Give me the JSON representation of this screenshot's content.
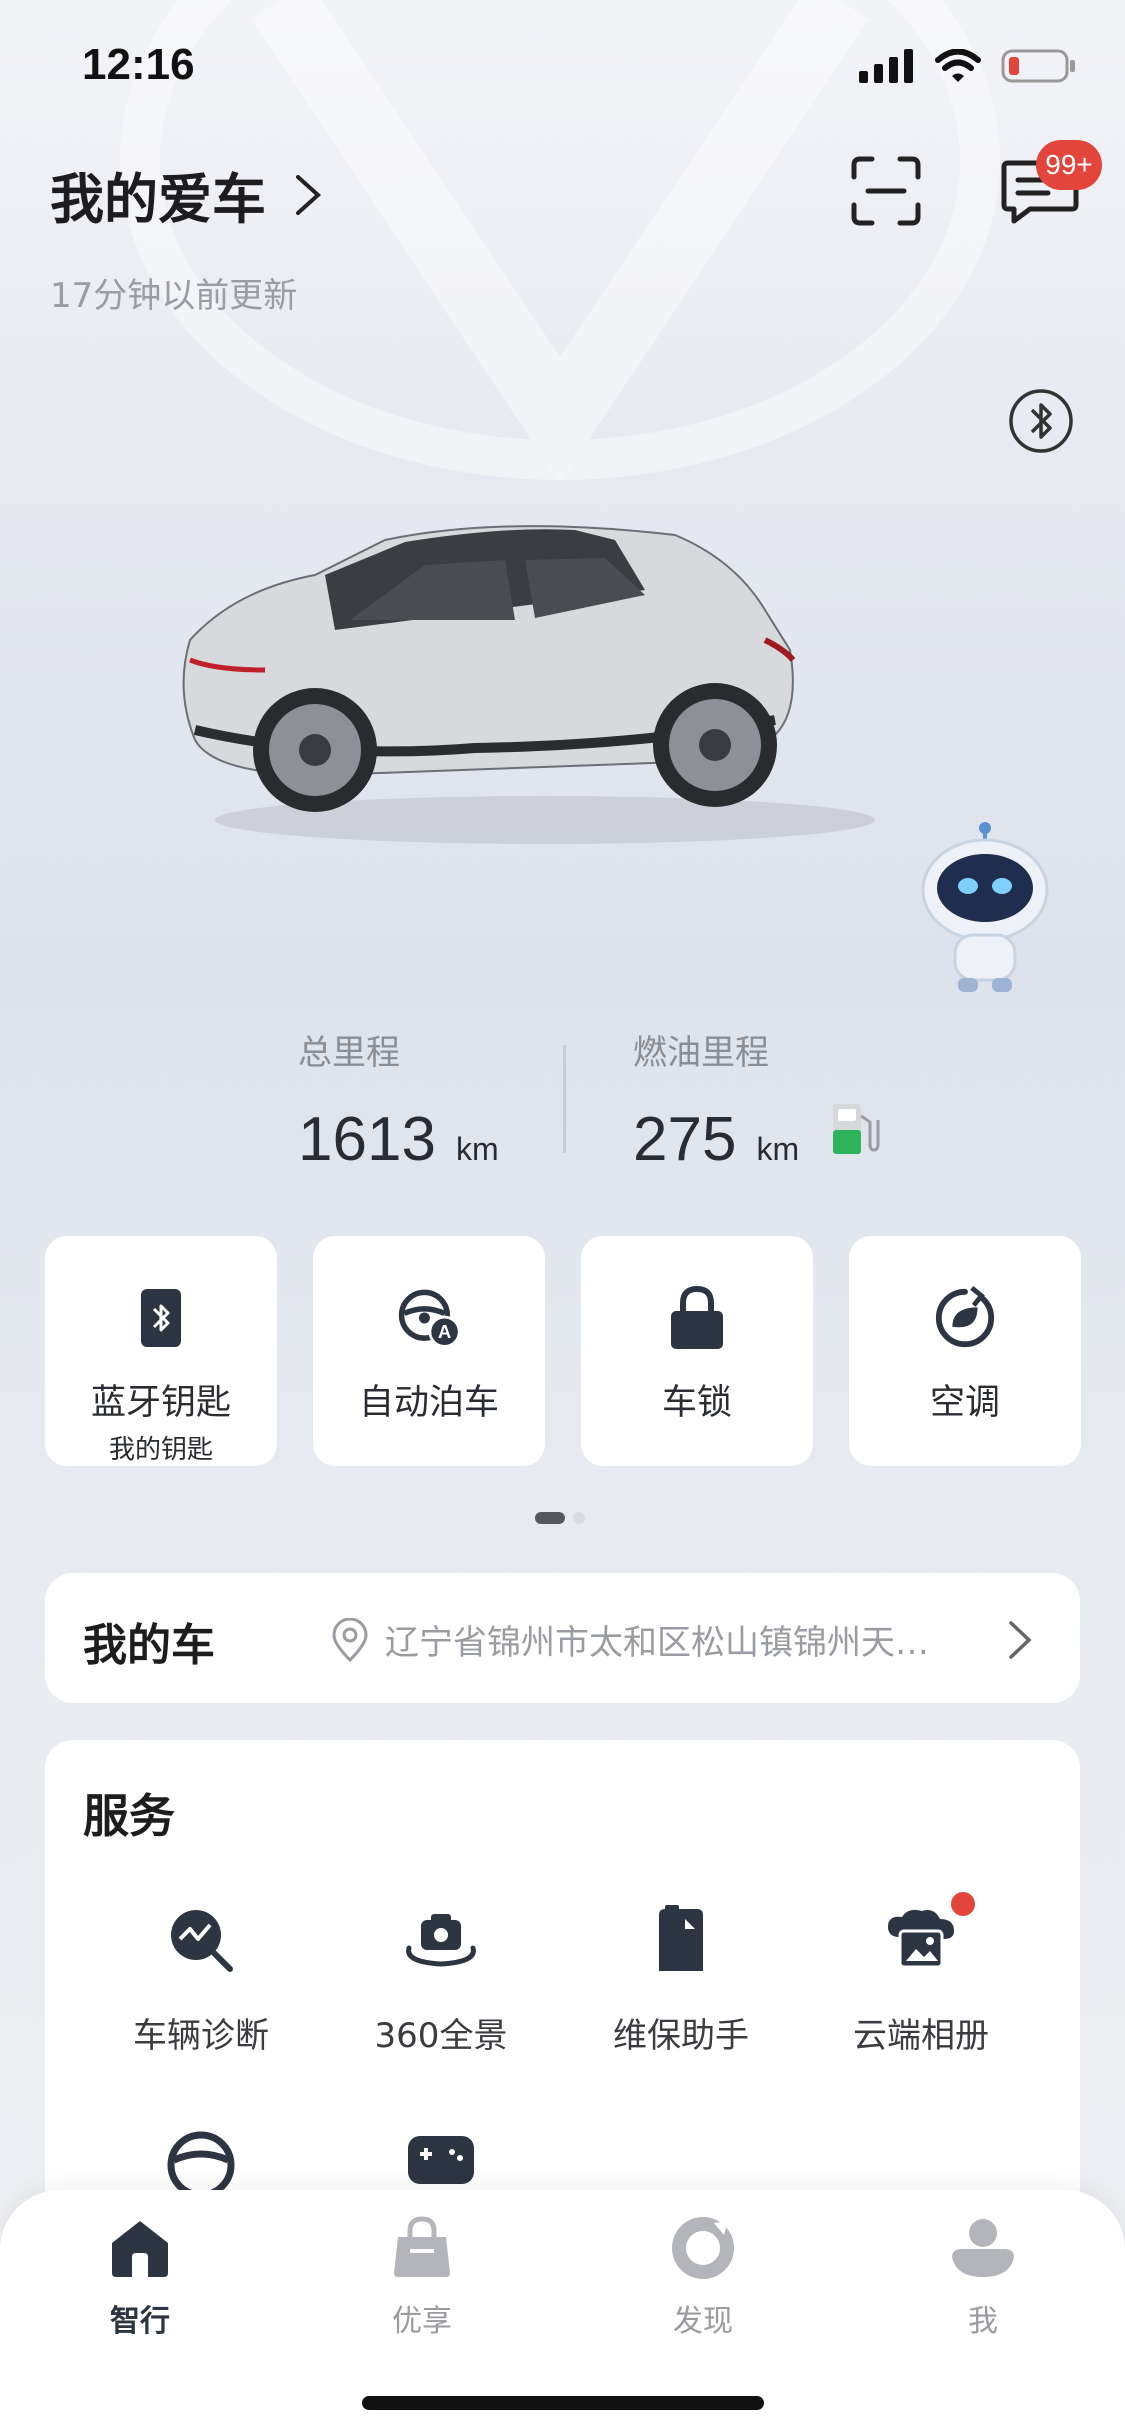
{
  "status_bar": {
    "time": "12:16"
  },
  "header": {
    "title": "我的爱车",
    "updated": "17分钟以前更新",
    "badge": "99+"
  },
  "stats": {
    "total_label": "总里程",
    "total_value": "1613",
    "total_unit": "km",
    "fuel_label": "燃油里程",
    "fuel_value": "275",
    "fuel_unit": "km"
  },
  "quick_actions": [
    {
      "label": "蓝牙钥匙",
      "sub": "我的钥匙",
      "icon": "bluetooth-key-icon"
    },
    {
      "label": "自动泊车",
      "icon": "auto-park-icon"
    },
    {
      "label": "车锁",
      "icon": "lock-icon"
    },
    {
      "label": "空调",
      "icon": "climate-icon"
    }
  ],
  "my_car": {
    "title": "我的车",
    "address": "辽宁省锦州市太和区松山镇锦州天…"
  },
  "services": {
    "title": "服务",
    "items": [
      {
        "label": "车辆诊断",
        "icon": "diagnosis-icon"
      },
      {
        "label": "360全景",
        "icon": "camera-360-icon"
      },
      {
        "label": "维保助手",
        "icon": "maintenance-icon"
      },
      {
        "label": "云端相册",
        "icon": "cloud-album-icon"
      }
    ]
  },
  "tabs": [
    {
      "label": "智行",
      "icon": "home-icon",
      "active": true
    },
    {
      "label": "优享",
      "icon": "bag-icon"
    },
    {
      "label": "发现",
      "icon": "discover-icon"
    },
    {
      "label": "我",
      "icon": "profile-icon"
    }
  ],
  "colors": {
    "accent": "#2e3542",
    "badge": "#e2453c",
    "fuel_green": "#2db35a"
  }
}
